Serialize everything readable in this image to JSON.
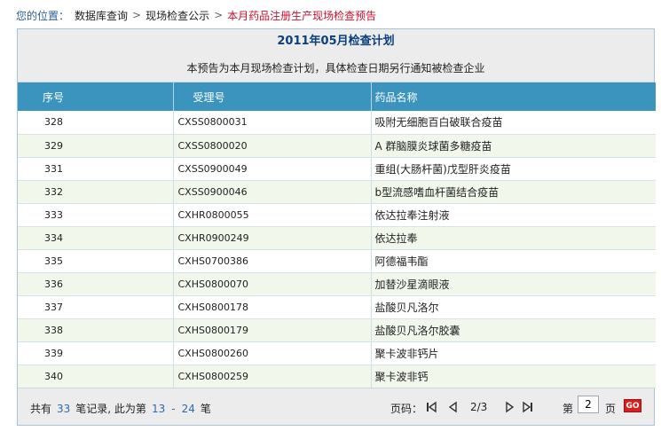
{
  "breadcrumb": {
    "prefix": "您的位置：",
    "items": [
      "数据库查询",
      "现场检查公示"
    ],
    "current": "本月药品注册生产现场检查预告",
    "separator": ">"
  },
  "panel": {
    "title": "2011年05月检查计划",
    "note": "本预告为本月现场检查计划，具体检查日期另行通知被检查企业"
  },
  "table": {
    "columns": [
      "序号",
      "受理号",
      "药品名称"
    ],
    "rows": [
      [
        "328",
        "CXSS0800031",
        "吸附无细胞百白破联合疫苗"
      ],
      [
        "329",
        "CXSS0800020",
        "A 群脑膜炎球菌多糖疫苗"
      ],
      [
        "331",
        "CXSS0900049",
        "重组(大肠杆菌)戊型肝炎疫苗"
      ],
      [
        "332",
        "CXSS0900046",
        "b型流感嗜血杆菌结合疫苗"
      ],
      [
        "333",
        "CXHR0800055",
        "依达拉奉注射液"
      ],
      [
        "334",
        "CXHR0900249",
        "依达拉奉"
      ],
      [
        "335",
        "CXHS0700386",
        "阿德福韦酯"
      ],
      [
        "336",
        "CXHS0800070",
        "加替沙星滴眼液"
      ],
      [
        "337",
        "CXHS0800178",
        "盐酸贝凡洛尔"
      ],
      [
        "338",
        "CXHS0800179",
        "盐酸贝凡洛尔胶囊"
      ],
      [
        "339",
        "CXHS0800260",
        "聚卡波非钙片"
      ],
      [
        "340",
        "CXHS0800259",
        "聚卡波非钙"
      ]
    ]
  },
  "pager": {
    "prefix": "共有",
    "total": "33",
    "mid": "笔记录, 此为第",
    "range_start": "13",
    "range_sep": "-",
    "range_end": "24",
    "suffix": "笔",
    "page_label": "页码：",
    "position": "2/3",
    "goto_label": "第",
    "goto_value": "2",
    "page_unit": "页",
    "go_label": "GO"
  }
}
